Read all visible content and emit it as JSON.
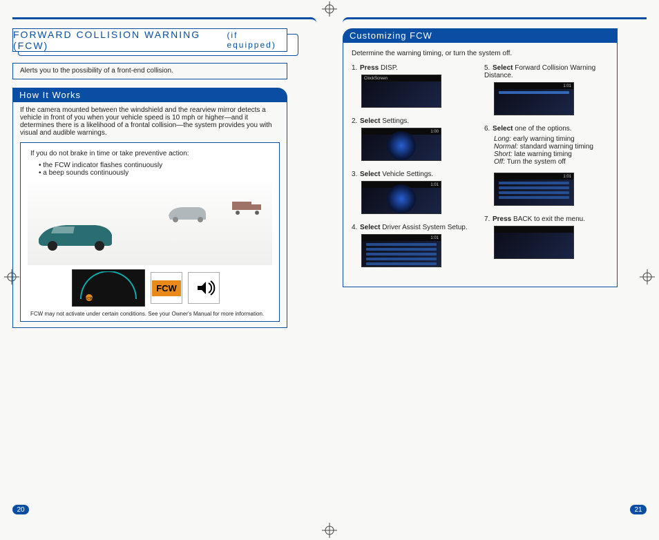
{
  "left": {
    "title_main": "FORWARD COLLISION WARNING (FCW)",
    "title_sub": "(if equipped)",
    "alert": "Alerts you to the possibility of a front-end collision.",
    "how_hdr": "How It Works",
    "how_body": "If the camera mounted between the windshield and the rearview mirror detects a vehicle in front of you when your vehicle speed is 10 mph or higher—and it determines there is a likelihood of a frontal collision—the system provides you with visual and audible warnings.",
    "demo_intro": "If you do not brake in time or take preventive action:",
    "demo_b1": "• the FCW indicator flashes continuously",
    "demo_b2": "• a beep sounds continuously",
    "fcw_label": "FCW",
    "footnote": "FCW may not activate under certain conditions. See your Owner's Manual for more information.",
    "page_num": "20"
  },
  "right": {
    "hdr": "Customizing FCW",
    "intro": "Determine the warning timing, or turn the system off.",
    "s1a": "Press",
    "s1b": " DISP.",
    "s2a": "Select",
    "s2b": " Settings.",
    "s3a": "Select",
    "s3b": " Vehicle Settings.",
    "s4a": "Select",
    "s4b": " Driver Assist System Setup.",
    "s5a": "Select",
    "s5b": " Forward Collision Warning Distance.",
    "s6a": "Select",
    "s6b": " one of the options.",
    "opt1i": "Long:",
    "opt1": " early warning timing",
    "opt2i": "Normal:",
    "opt2": " standard warning timing",
    "opt3i": "Short:",
    "opt3": " late warning timing",
    "opt4i": "Off:",
    "opt4": "  Turn the system off",
    "s7a": "Press",
    "s7b": " BACK to exit the menu.",
    "clock1": "1:00",
    "clock2": "1:01",
    "page_num": "21"
  }
}
